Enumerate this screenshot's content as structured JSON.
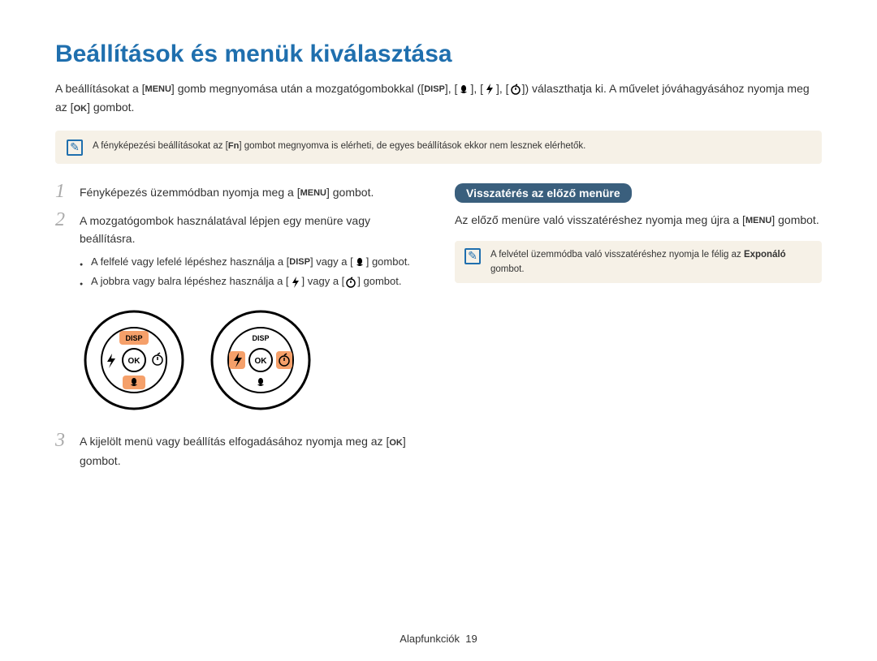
{
  "title": "Beállítások és menük kiválasztása",
  "intro": {
    "part1": "A beállításokat a [",
    "part2": "] gomb megnyomása után a mozgatógombokkal ([",
    "part3": "], [",
    "part4": "], [",
    "part5": "], [",
    "part6": "]) választhatja ki. A művelet jóváhagyásához nyomja meg az [",
    "part7": "] gombot."
  },
  "icons": {
    "menu": "MENU",
    "disp": "DISP",
    "ok": "OK",
    "fn": "Fn"
  },
  "infobox_top": {
    "part1": "A fényképezési beállításokat az [",
    "part2": "] gombot megnyomva is elérheti, de egyes beállítások ekkor nem lesznek elérhetők."
  },
  "steps": [
    {
      "num": "1",
      "pre": "Fényképezés üzemmódban nyomja meg a [",
      "post": "] gombot."
    },
    {
      "num": "2",
      "text": "A mozgatógombok használatával lépjen egy menüre vagy beállításra.",
      "bullets": [
        {
          "pre": "A felfelé vagy lefelé lépéshez használja a [",
          "post1": "] vagy a [",
          "post2": "] gombot."
        },
        {
          "pre": "A jobbra vagy balra lépéshez használja a [",
          "post1": "] vagy a [",
          "post2": "] gombot."
        }
      ]
    },
    {
      "num": "3",
      "pre": "A kijelölt menü vagy beállítás elfogadásához nyomja meg az [",
      "post": "] gombot."
    }
  ],
  "right": {
    "badge": "Visszatérés az előző menüre",
    "body_pre": "Az előző menüre való visszatéréshez nyomja meg újra a [",
    "body_post": "] gombot.",
    "info_pre": "A felvétel üzemmódba való visszatéréshez nyomja le félig az ",
    "info_bold": "Exponáló",
    "info_post": " gombot."
  },
  "footer": {
    "label": "Alapfunkciók",
    "page": "19"
  }
}
